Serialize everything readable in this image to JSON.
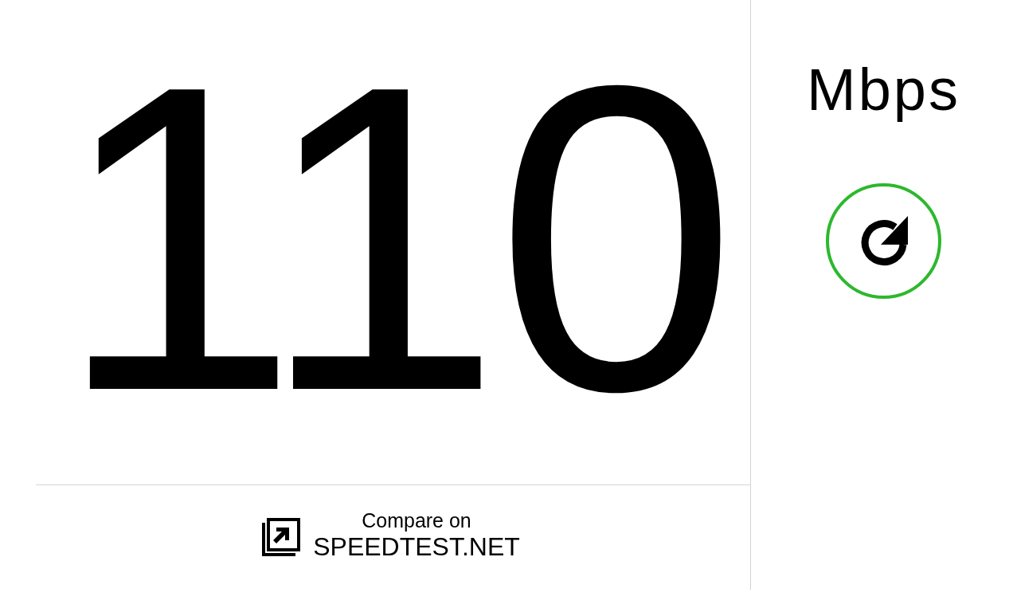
{
  "speed": {
    "value": "110",
    "unit": "Mbps"
  },
  "compare": {
    "line_1": "Compare on",
    "line_2": "SPEEDTEST.NET"
  }
}
